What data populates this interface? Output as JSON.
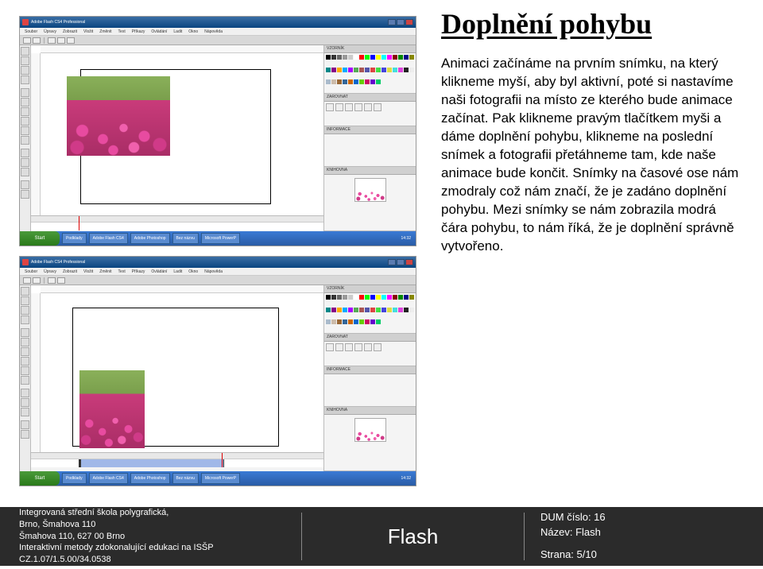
{
  "heading": "Doplnění pohybu",
  "body": "Animaci začínáme na prvním snímku, na který klikneme myší, aby byl aktivní, poté si nastavíme naši fotografii na místo ze kterého bude animace začínat. Pak klikneme pravým tlačítkem myši a dáme doplnění pohybu, klikneme na poslední snímek a fotografii přetáhneme tam, kde naše animace bude končit. Snímky na časové ose nám zmodraly což nám značí, že je zadáno doplnění pohybu. Mezi snímky se nám zobrazila modrá čára pohybu, to nám říká, že je doplnění správně vytvořeno.",
  "screenshot": {
    "app_title": "Adobe Flash CS4 Professional",
    "menu": [
      "Soubor",
      "Úpravy",
      "Zobrazit",
      "Vložit",
      "Změnit",
      "Text",
      "Příkazy",
      "Ovládání",
      "Ladit",
      "Okno",
      "Nápověda"
    ],
    "panels": {
      "swatches": "VZORNÍK",
      "align": "ZAROVNAT",
      "info": "INFORMACE",
      "library": "KNIHOVNA"
    },
    "taskbar": {
      "start": "Start",
      "items": [
        "Podklady",
        "Adobe Flash CS4",
        "Adobe Photoshop",
        "Bez názvu",
        "Microsoft PowerP"
      ],
      "time": "14:32"
    }
  },
  "footer": {
    "school1": "Integrovaná střední škola polygrafická,",
    "school2": "Brno, Šmahova 110",
    "school3": "Šmahova 110, 627 00 Brno",
    "project": "Interaktivní metody zdokonalující edukaci na ISŠP",
    "code": "CZ.1.07/1.5.00/34.0538",
    "center": "Flash",
    "dum": "DUM číslo: 16",
    "name": "Název: Flash",
    "page": "Strana: 5/10"
  },
  "swatch_colors": [
    "#000",
    "#333",
    "#666",
    "#999",
    "#ccc",
    "#fff",
    "#f00",
    "#0f0",
    "#00f",
    "#ff0",
    "#0ff",
    "#f0f",
    "#800",
    "#080",
    "#008",
    "#880",
    "#088",
    "#808",
    "#fa0",
    "#0af",
    "#a0f",
    "#5a5",
    "#a55",
    "#55a",
    "#d44",
    "#4d4",
    "#44d",
    "#dd4",
    "#4dd",
    "#d4d",
    "#222",
    "#eee",
    "#abc",
    "#cba",
    "#963",
    "#369",
    "#c60",
    "#06c",
    "#6c0",
    "#c06",
    "#60c",
    "#0c6"
  ]
}
